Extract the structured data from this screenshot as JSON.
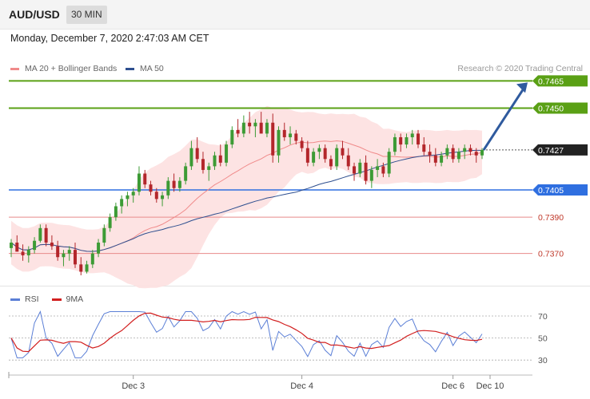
{
  "header": {
    "symbol": "AUD/USD",
    "timeframe": "30 MIN",
    "datetime": "Monday, December 7, 2020 2:47:03 AM CET"
  },
  "legend": {
    "ma20": {
      "label": "MA 20 + Bollinger Bands",
      "color": "#f08a8a"
    },
    "ma50": {
      "label": "MA 50",
      "color": "#2e4f8f"
    },
    "credit": "Research © 2020 Trading Central"
  },
  "rsi_legend": {
    "rsi": {
      "label": "RSI",
      "color": "#5b7fd6"
    },
    "ma9": {
      "label": "9MA",
      "color": "#d21f1f"
    }
  },
  "colors": {
    "up_candle": "#3d9b35",
    "down_candle": "#b3262b",
    "resistance": "#5aa015",
    "support": "#2f6fe0",
    "minor_support": "#e88a8a",
    "current": "#222222",
    "bollinger_fill": "#fde0e0",
    "arrow": "#2f5a9e"
  },
  "chart_data": {
    "type": "candlestick",
    "symbol": "AUD/USD",
    "ylim": [
      0.7358,
      0.747
    ],
    "x_tick_labels": [
      "Dec 3",
      "Dec 4",
      "Dec 6",
      "Dec 10"
    ],
    "price_levels": [
      {
        "value": 0.7465,
        "label": "0.7465",
        "kind": "resistance"
      },
      {
        "value": 0.745,
        "label": "0.7450",
        "kind": "resistance"
      },
      {
        "value": 0.7427,
        "label": "0.7427",
        "kind": "current"
      },
      {
        "value": 0.7405,
        "label": "0.7405",
        "kind": "support"
      },
      {
        "value": 0.739,
        "label": "0.7390",
        "kind": "minor-support"
      },
      {
        "value": 0.737,
        "label": "0.7370",
        "kind": "minor-support"
      }
    ],
    "candles_approx": [
      [
        0.7373,
        0.7378,
        0.7368,
        0.7376
      ],
      [
        0.7376,
        0.738,
        0.7372,
        0.7371
      ],
      [
        0.7371,
        0.7375,
        0.7366,
        0.7369
      ],
      [
        0.7369,
        0.7374,
        0.7365,
        0.7372
      ],
      [
        0.7372,
        0.7379,
        0.737,
        0.7377
      ],
      [
        0.7377,
        0.7386,
        0.7376,
        0.7384
      ],
      [
        0.7384,
        0.7386,
        0.7374,
        0.7376
      ],
      [
        0.7376,
        0.738,
        0.7372,
        0.7374
      ],
      [
        0.7374,
        0.7377,
        0.7366,
        0.7368
      ],
      [
        0.7368,
        0.7372,
        0.7363,
        0.737
      ],
      [
        0.737,
        0.7374,
        0.7366,
        0.7372
      ],
      [
        0.7372,
        0.7376,
        0.7362,
        0.7364
      ],
      [
        0.7364,
        0.7368,
        0.7358,
        0.736
      ],
      [
        0.736,
        0.7366,
        0.7359,
        0.7364
      ],
      [
        0.7364,
        0.7372,
        0.7362,
        0.737
      ],
      [
        0.737,
        0.7378,
        0.7368,
        0.7376
      ],
      [
        0.7376,
        0.7386,
        0.7374,
        0.7384
      ],
      [
        0.7384,
        0.7392,
        0.7382,
        0.739
      ],
      [
        0.739,
        0.7398,
        0.7388,
        0.7396
      ],
      [
        0.7396,
        0.7402,
        0.7392,
        0.74
      ],
      [
        0.74,
        0.7404,
        0.7396,
        0.7402
      ],
      [
        0.7402,
        0.7406,
        0.7398,
        0.7404
      ],
      [
        0.7404,
        0.7418,
        0.7402,
        0.7414
      ],
      [
        0.7414,
        0.7416,
        0.7406,
        0.7408
      ],
      [
        0.7408,
        0.741,
        0.7402,
        0.7404
      ],
      [
        0.7404,
        0.7406,
        0.7398,
        0.74
      ],
      [
        0.74,
        0.7404,
        0.7396,
        0.7402
      ],
      [
        0.7402,
        0.7412,
        0.74,
        0.741
      ],
      [
        0.741,
        0.7414,
        0.7404,
        0.7406
      ],
      [
        0.7406,
        0.7412,
        0.7404,
        0.741
      ],
      [
        0.741,
        0.742,
        0.7408,
        0.7418
      ],
      [
        0.7418,
        0.7432,
        0.7416,
        0.7428
      ],
      [
        0.7428,
        0.7434,
        0.742,
        0.7422
      ],
      [
        0.7422,
        0.7426,
        0.7414,
        0.7416
      ],
      [
        0.7416,
        0.742,
        0.741,
        0.7418
      ],
      [
        0.7418,
        0.7426,
        0.7416,
        0.7424
      ],
      [
        0.7424,
        0.743,
        0.7418,
        0.742
      ],
      [
        0.742,
        0.7432,
        0.7418,
        0.743
      ],
      [
        0.743,
        0.744,
        0.7428,
        0.7438
      ],
      [
        0.7438,
        0.7444,
        0.7434,
        0.7436
      ],
      [
        0.7436,
        0.7446,
        0.7434,
        0.7442
      ],
      [
        0.7442,
        0.7448,
        0.7436,
        0.744
      ],
      [
        0.744,
        0.7444,
        0.7434,
        0.7442
      ],
      [
        0.7442,
        0.7448,
        0.7438,
        0.7436
      ],
      [
        0.7436,
        0.7444,
        0.7434,
        0.7442
      ],
      [
        0.7442,
        0.7447,
        0.742,
        0.7424
      ],
      [
        0.7424,
        0.744,
        0.742,
        0.7438
      ],
      [
        0.7438,
        0.7442,
        0.7432,
        0.7434
      ],
      [
        0.7434,
        0.744,
        0.743,
        0.7436
      ],
      [
        0.7436,
        0.7438,
        0.743,
        0.7432
      ],
      [
        0.7432,
        0.7434,
        0.7426,
        0.7428
      ],
      [
        0.7428,
        0.7432,
        0.7418,
        0.742
      ],
      [
        0.742,
        0.7428,
        0.7418,
        0.7426
      ],
      [
        0.7426,
        0.743,
        0.7422,
        0.7428
      ],
      [
        0.7428,
        0.743,
        0.742,
        0.7422
      ],
      [
        0.7422,
        0.7424,
        0.7416,
        0.7418
      ],
      [
        0.7418,
        0.743,
        0.7416,
        0.7428
      ],
      [
        0.7428,
        0.7432,
        0.7422,
        0.7424
      ],
      [
        0.7424,
        0.7428,
        0.7416,
        0.7418
      ],
      [
        0.7418,
        0.742,
        0.741,
        0.7414
      ],
      [
        0.7414,
        0.7422,
        0.7412,
        0.742
      ],
      [
        0.742,
        0.7424,
        0.7408,
        0.741
      ],
      [
        0.741,
        0.7418,
        0.7406,
        0.7416
      ],
      [
        0.7416,
        0.7422,
        0.7412,
        0.7418
      ],
      [
        0.7418,
        0.742,
        0.7412,
        0.7414
      ],
      [
        0.7414,
        0.7428,
        0.7412,
        0.7426
      ],
      [
        0.7426,
        0.7436,
        0.7424,
        0.7434
      ],
      [
        0.7434,
        0.7436,
        0.7426,
        0.743
      ],
      [
        0.743,
        0.7436,
        0.7428,
        0.7434
      ],
      [
        0.7434,
        0.7438,
        0.743,
        0.7436
      ],
      [
        0.7436,
        0.7438,
        0.7428,
        0.743
      ],
      [
        0.743,
        0.7434,
        0.7424,
        0.7426
      ],
      [
        0.7426,
        0.743,
        0.742,
        0.7424
      ],
      [
        0.7424,
        0.7428,
        0.7418,
        0.742
      ],
      [
        0.742,
        0.7426,
        0.7418,
        0.7424
      ],
      [
        0.7424,
        0.743,
        0.7422,
        0.7428
      ],
      [
        0.7428,
        0.743,
        0.742,
        0.7422
      ],
      [
        0.7422,
        0.7428,
        0.742,
        0.7426
      ],
      [
        0.7426,
        0.743,
        0.7422,
        0.7428
      ],
      [
        0.7428,
        0.743,
        0.7424,
        0.7426
      ],
      [
        0.7426,
        0.7428,
        0.742,
        0.7424
      ],
      [
        0.7424,
        0.7428,
        0.7422,
        0.7427
      ]
    ]
  },
  "rsi_chart": {
    "type": "line",
    "ylim": [
      20,
      78
    ],
    "levels": [
      70,
      50,
      30
    ],
    "level_labels": [
      "70",
      "50",
      "30"
    ]
  }
}
